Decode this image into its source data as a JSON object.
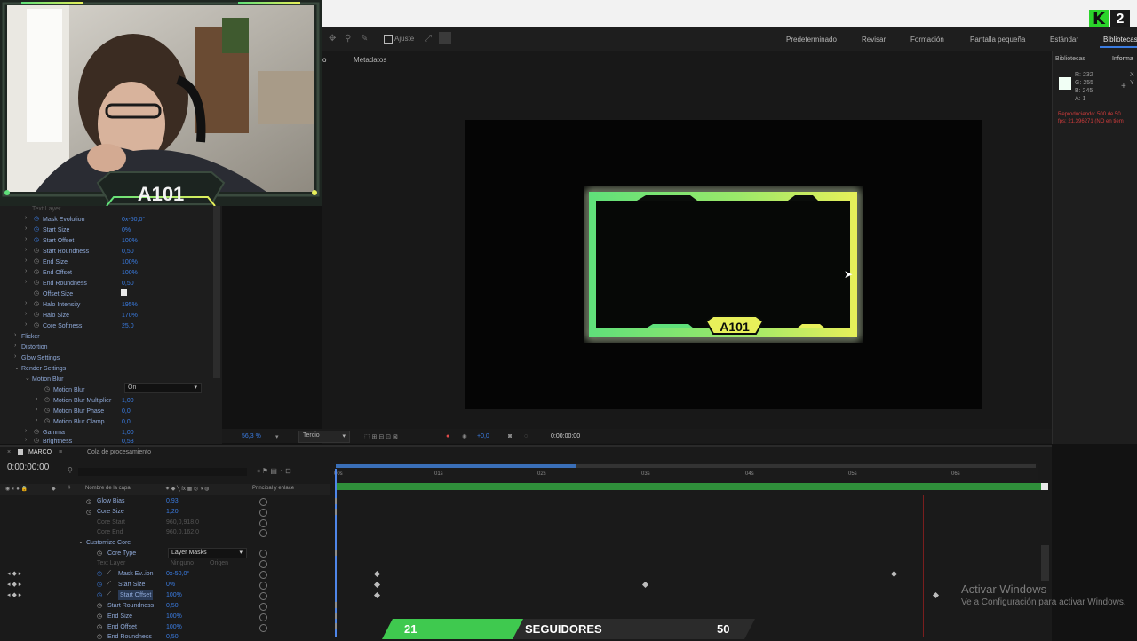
{
  "overlay": {
    "kick_logo": "K",
    "kick_count": "2",
    "webcam_badge": "A101",
    "frame_badge": "A101",
    "goal_bar": {
      "start": "21",
      "label": "SEGUIDORES",
      "goal": "50",
      "progress": 0.35
    }
  },
  "toolbar": {
    "snap_label": "Ajuste",
    "workspaces": [
      "Predeterminado",
      "Revisar",
      "Formación",
      "Pantalla pequeña",
      "Estándar",
      "Bibliotecas"
    ]
  },
  "viewer": {
    "tab_partial": "o",
    "tab_metadata": "Metadatos",
    "zoom": "56,3 %",
    "resolution": "Tercio",
    "exposure": "+0,0",
    "timecode": "0:00:00:00"
  },
  "right_panel": {
    "tab_libraries": "Bibliotecas",
    "tab_info": "Informa",
    "r": "R: 232",
    "g": "G: 255",
    "b": "B: 245",
    "a": "A: 1",
    "x_label": "X",
    "y_label": "Y",
    "render_line1": "Reproduciendo: 500 de 50",
    "render_line2": "fps: 21,396271 (NO en tiem"
  },
  "effects": {
    "rows": [
      {
        "label": "Text Layer",
        "value": ""
      },
      {
        "label": "Mask Evolution",
        "value": "0x-50,0°"
      },
      {
        "label": "Start Size",
        "value": "0%"
      },
      {
        "label": "Start Offset",
        "value": "100%"
      },
      {
        "label": "Start Roundness",
        "value": "0,50"
      },
      {
        "label": "End Size",
        "value": "100%"
      },
      {
        "label": "End Offset",
        "value": "100%"
      },
      {
        "label": "End Roundness",
        "value": "0,50"
      },
      {
        "label": "Offset Size",
        "value": ""
      },
      {
        "label": "Halo Intensity",
        "value": "195%"
      },
      {
        "label": "Halo Size",
        "value": "170%"
      },
      {
        "label": "Core Softness",
        "value": "25,0"
      },
      {
        "label": "Flicker",
        "value": ""
      },
      {
        "label": "Distortion",
        "value": ""
      },
      {
        "label": "Glow Settings",
        "value": ""
      },
      {
        "label": "Render Settings",
        "value": ""
      },
      {
        "label": "Motion Blur",
        "value": ""
      },
      {
        "label": "Motion Blur",
        "value": "On"
      },
      {
        "label": "Motion Blur Multiplier",
        "value": "1,00"
      },
      {
        "label": "Motion Blur Phase",
        "value": "0,0"
      },
      {
        "label": "Motion Blur Clamp",
        "value": "0,0"
      },
      {
        "label": "Gamma",
        "value": "1,00"
      },
      {
        "label": "Brightness",
        "value": "0,53"
      }
    ]
  },
  "timeline": {
    "tab_marco": "MARCO",
    "tab_queue": "Cola de procesamiento",
    "timecode": "0:00:00:00",
    "col_layer_name": "Nombre de la capa",
    "col_parent": "Principal y enlace",
    "ticks": [
      "00s",
      "01s",
      "02s",
      "03s",
      "04s",
      "05s",
      "06s"
    ],
    "rows": [
      {
        "label": "Glow Bias",
        "value": "0,93"
      },
      {
        "label": "Core Size",
        "value": "1,20"
      },
      {
        "label": "Core Start",
        "value": "960,0,918,0"
      },
      {
        "label": "Core End",
        "value": "960,0,162,0"
      },
      {
        "label": "Customize Core",
        "value": ""
      },
      {
        "label": "Core Type",
        "value": "Layer Masks"
      },
      {
        "label": "Text Layer",
        "value": "Ninguno"
      },
      {
        "label": "Mask Ev..ion",
        "value": "0x-50,0°"
      },
      {
        "label": "Start Size",
        "value": "0%"
      },
      {
        "label": "Start Offset",
        "value": "100%"
      },
      {
        "label": "Start Roundness",
        "value": "0,50"
      },
      {
        "label": "End Size",
        "value": "100%"
      },
      {
        "label": "End Offset",
        "value": "100%"
      },
      {
        "label": "End Roundness",
        "value": "0,50"
      }
    ],
    "text_layer_source": "Origen"
  },
  "watermark": {
    "line1": "Activar Windows",
    "line2": "Ve a Configuración para activar Windows."
  },
  "colors": {
    "accent_green": "#5fe07a",
    "accent_yellow": "#e8f05a",
    "ae_blue": "#3a7be0"
  }
}
